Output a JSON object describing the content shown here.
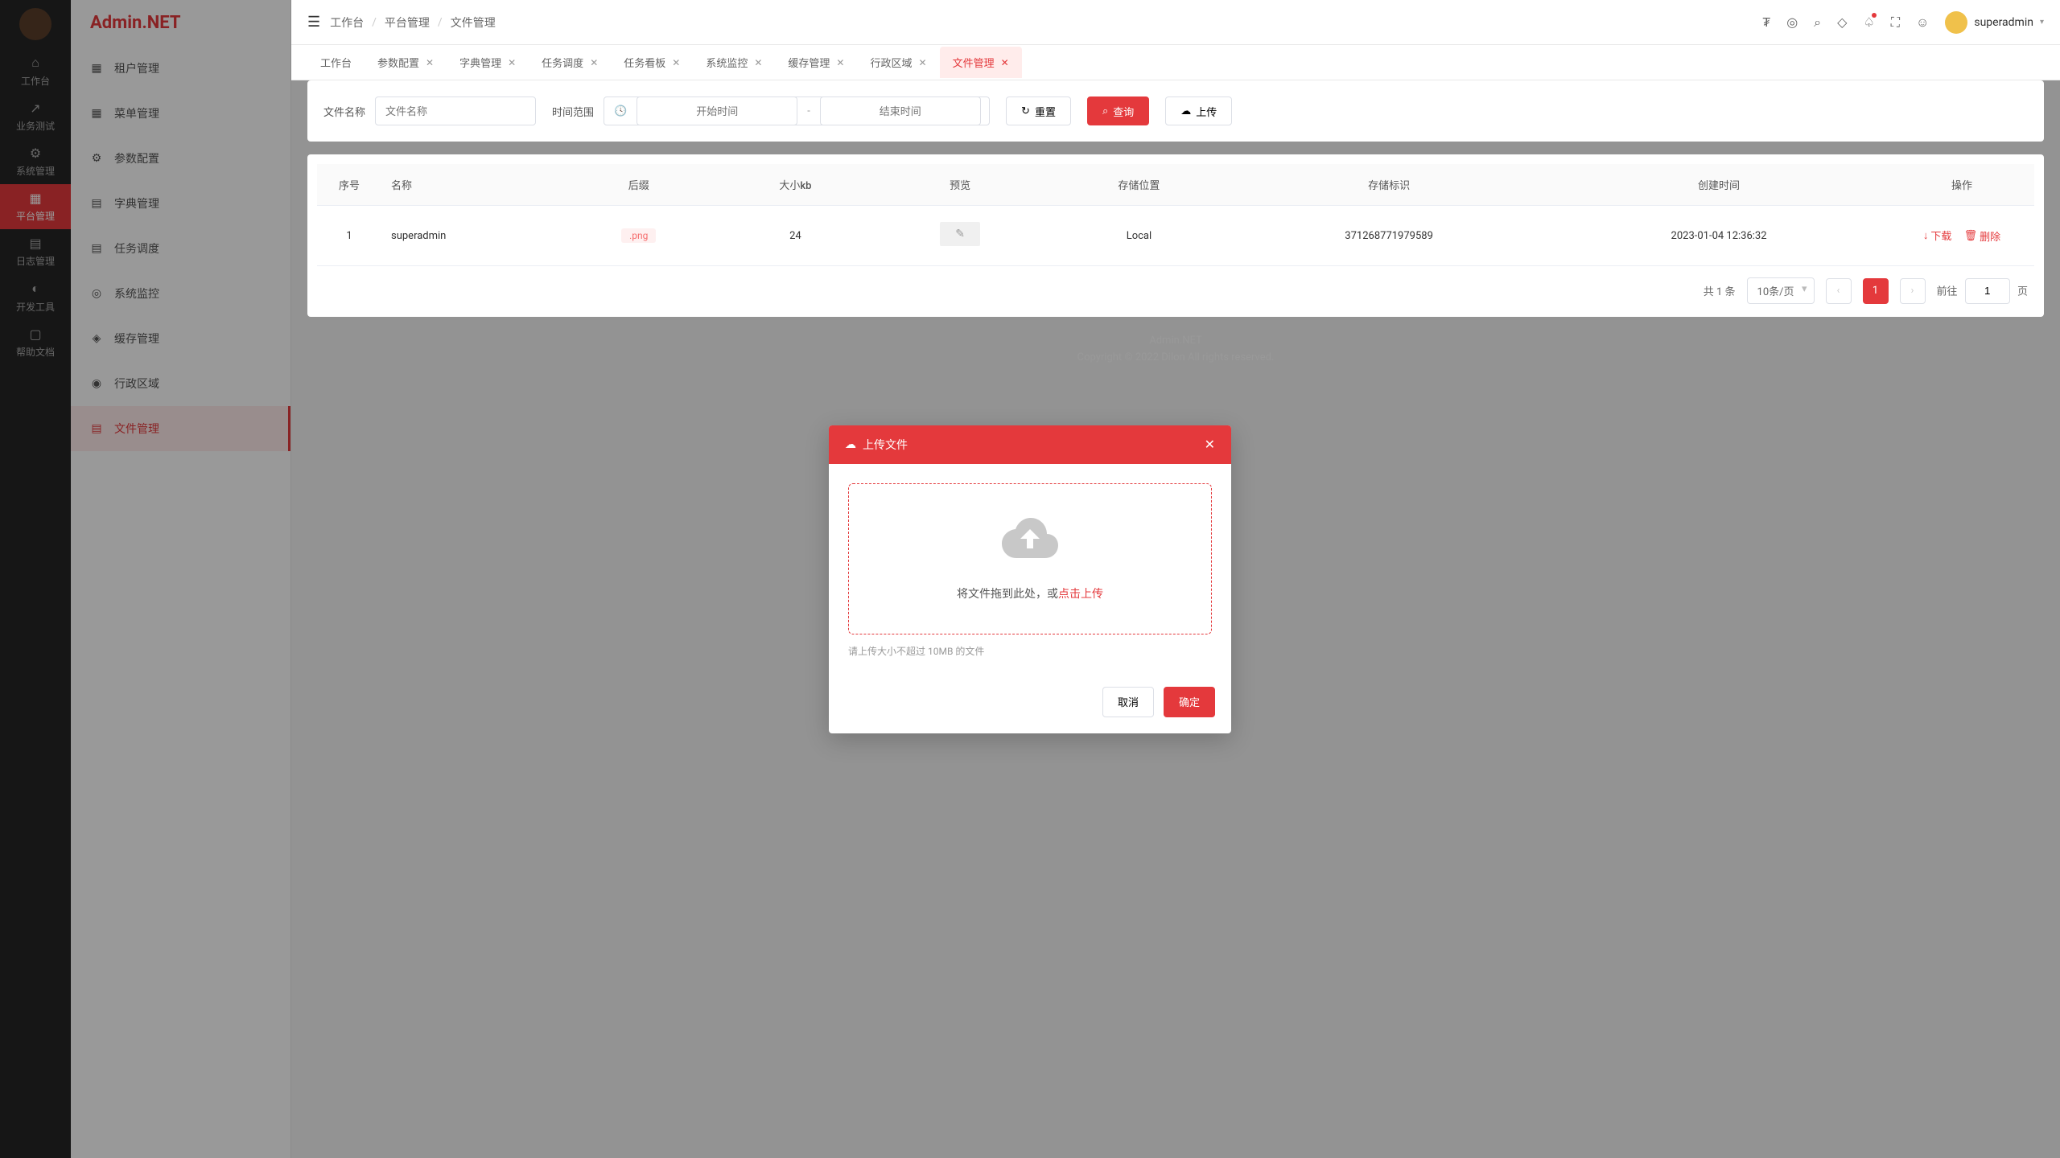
{
  "brand": "Admin.NET",
  "iconNav": [
    {
      "label": "工作台",
      "active": false
    },
    {
      "label": "业务测试",
      "active": false
    },
    {
      "label": "系统管理",
      "active": false
    },
    {
      "label": "平台管理",
      "active": true
    },
    {
      "label": "日志管理",
      "active": false
    },
    {
      "label": "开发工具",
      "active": false
    },
    {
      "label": "帮助文档",
      "active": false
    }
  ],
  "subMenu": [
    {
      "label": "租户管理",
      "active": false
    },
    {
      "label": "菜单管理",
      "active": false
    },
    {
      "label": "参数配置",
      "active": false
    },
    {
      "label": "字典管理",
      "active": false
    },
    {
      "label": "任务调度",
      "active": false
    },
    {
      "label": "系统监控",
      "active": false
    },
    {
      "label": "缓存管理",
      "active": false
    },
    {
      "label": "行政区域",
      "active": false
    },
    {
      "label": "文件管理",
      "active": true
    }
  ],
  "breadcrumb": [
    "工作台",
    "平台管理",
    "文件管理"
  ],
  "user": {
    "name": "superadmin"
  },
  "tabs": [
    {
      "label": "工作台",
      "closable": false,
      "active": false
    },
    {
      "label": "参数配置",
      "closable": true,
      "active": false
    },
    {
      "label": "字典管理",
      "closable": true,
      "active": false
    },
    {
      "label": "任务调度",
      "closable": true,
      "active": false
    },
    {
      "label": "任务看板",
      "closable": true,
      "active": false
    },
    {
      "label": "系统监控",
      "closable": true,
      "active": false
    },
    {
      "label": "缓存管理",
      "closable": true,
      "active": false
    },
    {
      "label": "行政区域",
      "closable": true,
      "active": false
    },
    {
      "label": "文件管理",
      "closable": true,
      "active": true
    }
  ],
  "filter": {
    "nameLabel": "文件名称",
    "namePlaceholder": "文件名称",
    "timeLabel": "时间范围",
    "startPlaceholder": "开始时间",
    "endPlaceholder": "结束时间",
    "resetLabel": "重置",
    "searchLabel": "查询",
    "uploadLabel": "上传"
  },
  "table": {
    "columns": [
      "序号",
      "名称",
      "后缀",
      "大小kb",
      "预览",
      "存储位置",
      "存储标识",
      "创建时间",
      "操作"
    ],
    "rows": [
      {
        "seq": "1",
        "name": "superadmin",
        "ext": ".png",
        "size": "24",
        "location": "Local",
        "ident": "371268771979589",
        "created": "2023-01-04 12:36:32"
      }
    ],
    "ops": {
      "download": "下载",
      "delete": "删除"
    }
  },
  "pagination": {
    "total": "共 1 条",
    "pageSize": "10条/页",
    "current": "1",
    "jumpLabel": "前往",
    "jumpValue": "1",
    "jumpSuffix": "页"
  },
  "footer": {
    "line1": "Admin.NET",
    "line2": "Copyright © 2022 Dilon All rights reserved."
  },
  "modal": {
    "title": "上传文件",
    "dropTextPrefix": "将文件拖到此处，或",
    "dropTextEm": "点击上传",
    "hint": "请上传大小不超过 10MB 的文件",
    "cancel": "取消",
    "confirm": "确定"
  }
}
